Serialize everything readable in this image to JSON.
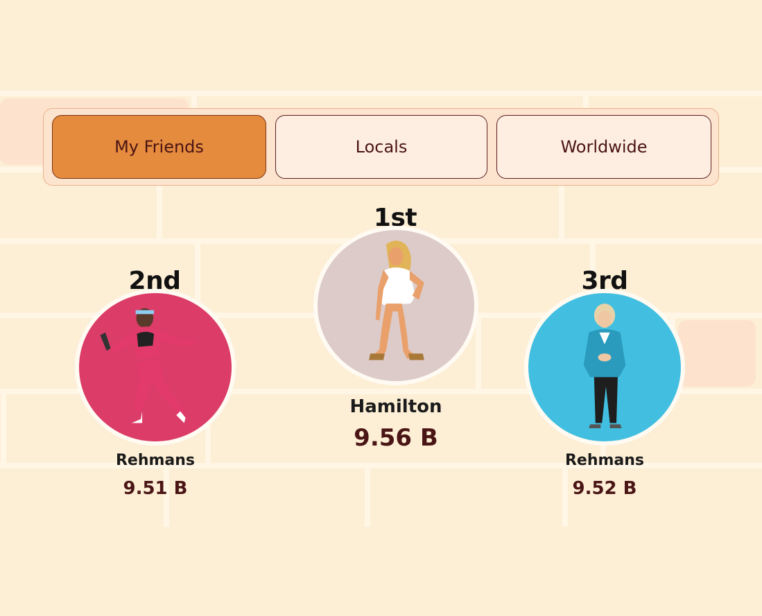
{
  "tabs": [
    {
      "label": "My Friends",
      "active": true
    },
    {
      "label": "Locals",
      "active": false
    },
    {
      "label": "Worldwide",
      "active": false
    }
  ],
  "podium": {
    "first": {
      "rank": "1st",
      "name": "Hamilton",
      "score": "9.56 B",
      "avatar_color": "#dccbc9"
    },
    "second": {
      "rank": "2nd",
      "name": "Rehmans",
      "score": "9.51 B",
      "avatar_color": "#db3c68"
    },
    "third": {
      "rank": "3rd",
      "name": "Rehmans",
      "score": "9.52 B",
      "avatar_color": "#42bfe0"
    }
  },
  "colors": {
    "background": "#fdefd6",
    "tab_active": "#e48b3d",
    "tab_inactive": "#fdeee1",
    "text_dark": "#4b1414"
  }
}
